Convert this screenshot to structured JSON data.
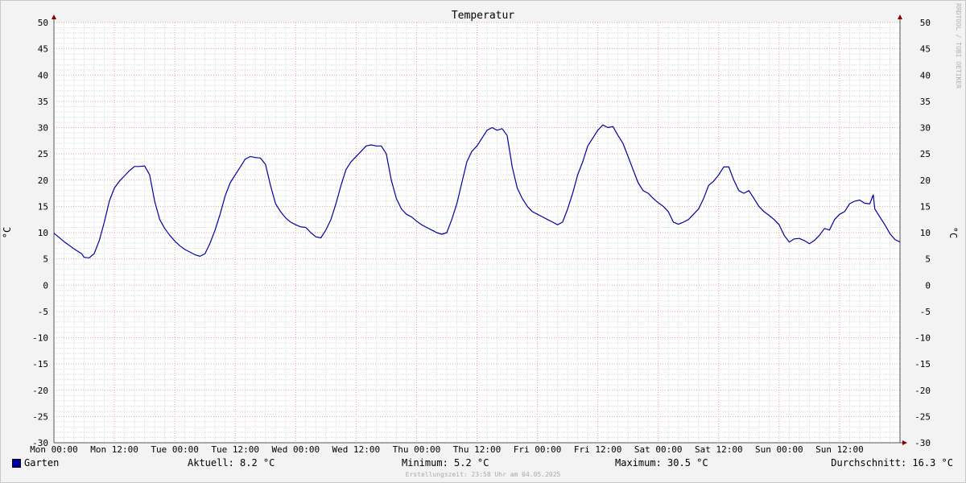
{
  "chart_data": {
    "type": "line",
    "title": "Temperatur",
    "ylabel": "°C",
    "ylim": [
      -30,
      50
    ],
    "yticks": [
      50,
      45,
      40,
      35,
      30,
      25,
      20,
      15,
      10,
      5,
      0,
      -5,
      -10,
      -15,
      -20,
      -25,
      -30
    ],
    "xlim": [
      0,
      168
    ],
    "xticks": [
      {
        "x": 0,
        "label": "Mon 00:00"
      },
      {
        "x": 12,
        "label": "Mon 12:00"
      },
      {
        "x": 24,
        "label": "Tue 00:00"
      },
      {
        "x": 36,
        "label": "Tue 12:00"
      },
      {
        "x": 48,
        "label": "Wed 00:00"
      },
      {
        "x": 60,
        "label": "Wed 12:00"
      },
      {
        "x": 72,
        "label": "Thu 00:00"
      },
      {
        "x": 84,
        "label": "Thu 12:00"
      },
      {
        "x": 96,
        "label": "Fri 00:00"
      },
      {
        "x": 108,
        "label": "Fri 12:00"
      },
      {
        "x": 120,
        "label": "Sat 00:00"
      },
      {
        "x": 132,
        "label": "Sat 12:00"
      },
      {
        "x": 144,
        "label": "Sun 00:00"
      },
      {
        "x": 156,
        "label": "Sun 12:00"
      }
    ],
    "grid": true,
    "series": [
      {
        "name": "Garten",
        "color": "#0000a0",
        "points": [
          [
            0,
            9.9
          ],
          [
            2,
            8.3
          ],
          [
            4,
            6.9
          ],
          [
            5.5,
            6.0
          ],
          [
            6,
            5.3
          ],
          [
            7,
            5.2
          ],
          [
            8,
            6.0
          ],
          [
            9,
            8.5
          ],
          [
            10,
            12.0
          ],
          [
            11,
            16.0
          ],
          [
            12,
            18.5
          ],
          [
            13,
            19.8
          ],
          [
            14,
            20.8
          ],
          [
            15,
            21.8
          ],
          [
            16,
            22.6
          ],
          [
            17,
            22.6
          ],
          [
            18,
            22.7
          ],
          [
            19,
            21.0
          ],
          [
            20,
            16.0
          ],
          [
            21,
            12.5
          ],
          [
            22,
            10.8
          ],
          [
            23,
            9.5
          ],
          [
            24,
            8.4
          ],
          [
            25,
            7.5
          ],
          [
            26,
            6.8
          ],
          [
            27,
            6.3
          ],
          [
            28,
            5.8
          ],
          [
            29,
            5.5
          ],
          [
            30,
            6.0
          ],
          [
            31,
            8.0
          ],
          [
            32,
            10.5
          ],
          [
            33,
            13.5
          ],
          [
            34,
            17.0
          ],
          [
            35,
            19.5
          ],
          [
            36,
            21.0
          ],
          [
            37,
            22.5
          ],
          [
            38,
            24.0
          ],
          [
            39,
            24.5
          ],
          [
            40,
            24.3
          ],
          [
            41,
            24.2
          ],
          [
            42,
            23.0
          ],
          [
            43,
            19.0
          ],
          [
            44,
            15.5
          ],
          [
            45,
            14.0
          ],
          [
            46,
            12.8
          ],
          [
            47,
            12.0
          ],
          [
            48,
            11.5
          ],
          [
            49,
            11.1
          ],
          [
            50,
            11.0
          ],
          [
            51,
            10.0
          ],
          [
            52,
            9.2
          ],
          [
            53,
            9.0
          ],
          [
            54,
            10.5
          ],
          [
            55,
            12.5
          ],
          [
            56,
            15.5
          ],
          [
            57,
            19.0
          ],
          [
            58,
            22.0
          ],
          [
            59,
            23.5
          ],
          [
            60,
            24.5
          ],
          [
            61,
            25.5
          ],
          [
            62,
            26.5
          ],
          [
            63,
            26.7
          ],
          [
            64,
            26.5
          ],
          [
            65,
            26.5
          ],
          [
            66,
            25.0
          ],
          [
            67,
            20.0
          ],
          [
            68,
            16.5
          ],
          [
            69,
            14.5
          ],
          [
            70,
            13.5
          ],
          [
            71,
            13.0
          ],
          [
            72,
            12.2
          ],
          [
            73,
            11.5
          ],
          [
            74,
            11.0
          ],
          [
            75,
            10.5
          ],
          [
            76,
            10.0
          ],
          [
            77,
            9.7
          ],
          [
            78,
            10.0
          ],
          [
            79,
            12.5
          ],
          [
            80,
            15.5
          ],
          [
            81,
            19.5
          ],
          [
            82,
            23.5
          ],
          [
            83,
            25.5
          ],
          [
            84,
            26.5
          ],
          [
            85,
            28.0
          ],
          [
            86,
            29.5
          ],
          [
            87,
            30.0
          ],
          [
            88,
            29.5
          ],
          [
            89,
            29.8
          ],
          [
            90,
            28.5
          ],
          [
            91,
            22.5
          ],
          [
            92,
            18.5
          ],
          [
            93,
            16.5
          ],
          [
            94,
            15.0
          ],
          [
            95,
            14.0
          ],
          [
            96,
            13.5
          ],
          [
            97,
            13.0
          ],
          [
            98,
            12.5
          ],
          [
            99,
            12.0
          ],
          [
            100,
            11.5
          ],
          [
            101,
            12.0
          ],
          [
            102,
            14.5
          ],
          [
            103,
            17.5
          ],
          [
            104,
            21.0
          ],
          [
            105,
            23.5
          ],
          [
            106,
            26.5
          ],
          [
            107,
            28.0
          ],
          [
            108,
            29.5
          ],
          [
            109,
            30.5
          ],
          [
            110,
            30.0
          ],
          [
            111,
            30.2
          ],
          [
            112,
            28.5
          ],
          [
            113,
            27.0
          ],
          [
            114,
            24.5
          ],
          [
            115,
            22.0
          ],
          [
            116,
            19.5
          ],
          [
            117,
            18.0
          ],
          [
            118,
            17.5
          ],
          [
            119,
            16.5
          ],
          [
            120,
            15.7
          ],
          [
            121,
            15.0
          ],
          [
            122,
            14.0
          ],
          [
            123,
            12.0
          ],
          [
            124,
            11.6
          ],
          [
            125,
            12.0
          ],
          [
            126,
            12.5
          ],
          [
            127,
            13.5
          ],
          [
            128,
            14.5
          ],
          [
            129,
            16.5
          ],
          [
            130,
            19.0
          ],
          [
            131,
            19.8
          ],
          [
            132,
            21.0
          ],
          [
            133,
            22.5
          ],
          [
            134,
            22.5
          ],
          [
            135,
            20.0
          ],
          [
            136,
            18.0
          ],
          [
            137,
            17.5
          ],
          [
            138,
            18.0
          ],
          [
            139,
            16.5
          ],
          [
            140,
            15.0
          ],
          [
            141,
            14.0
          ],
          [
            142,
            13.3
          ],
          [
            143,
            12.5
          ],
          [
            144,
            11.5
          ],
          [
            145,
            9.5
          ],
          [
            146,
            8.2
          ],
          [
            147,
            8.8
          ],
          [
            148,
            8.9
          ],
          [
            149,
            8.5
          ],
          [
            150,
            7.9
          ],
          [
            151,
            8.5
          ],
          [
            152,
            9.5
          ],
          [
            153,
            10.8
          ],
          [
            154,
            10.5
          ],
          [
            155,
            12.5
          ],
          [
            156,
            13.5
          ],
          [
            157,
            14.0
          ],
          [
            158,
            15.5
          ],
          [
            159,
            16.0
          ],
          [
            160,
            16.2
          ],
          [
            161,
            15.6
          ],
          [
            162,
            15.5
          ],
          [
            162.7,
            17.2
          ],
          [
            163,
            14.5
          ],
          [
            164,
            13.0
          ],
          [
            165,
            11.5
          ],
          [
            166,
            9.8
          ],
          [
            167,
            8.7
          ],
          [
            168,
            8.2
          ]
        ]
      }
    ]
  },
  "side_label": "RRDTOOL / TOBI OETIKER",
  "legend": {
    "series_name": "Garten",
    "current": "Aktuell: 8.2 °C",
    "minimum": "Minimum: 5.2 °C",
    "maximum": "Maximum: 30.5 °C",
    "average": "Durchschnitt: 16.3 °C",
    "swatch_color": "#0000a0"
  },
  "footer": "Erstellungszeit: 23:58 Uhr am 04.05.2025"
}
